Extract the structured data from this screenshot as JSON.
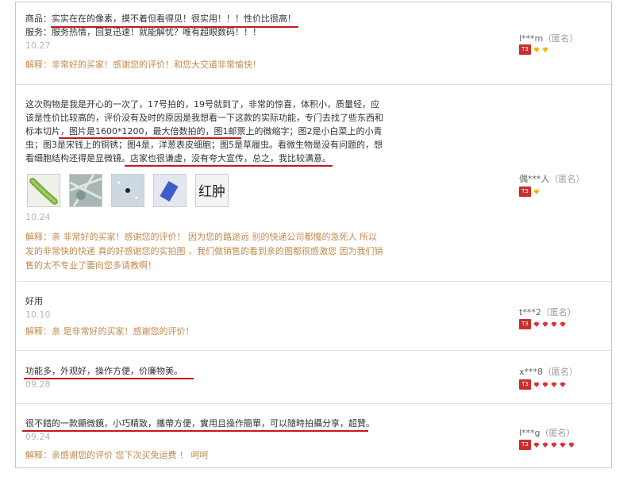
{
  "reviews": [
    {
      "lines": [
        "商品：实实在在的像素，摸不着但看得见！很实用！！！性价比很高！",
        "服务：服务热情，回复迅速！就能解忧？唯有超眼数码！！！"
      ],
      "date": "10.27",
      "reply": "解释：非常好的买家！感谢您的评价！和您大交道非常愉快！",
      "user": "l***m",
      "anon": "（匿名）",
      "level": "T3",
      "gem_color": "#f2b705",
      "gem_count": 2
    },
    {
      "lines": [
        "这次购物是我是开心的一次了，17号拍的，19号就到了，非常的惊喜，体积小，质量轻，应",
        "该是性价比较高的，评价没有及时的原因是我想看一下这款的实际功能，专门去找了些东西和",
        "标本切片，图片是1600*1200，最大倍数拍的，图1邮票上的微缩字；图2是小白菜上的小青",
        "虫；图3是宋钱上的铜锈；图4是，洋葱表皮细胞；图5是草履虫。看微生物是没有问题的，想",
        "看细胞结构还得是显微镜。店家也很谦虚，没有夸大宣传，总之，我比较满意。"
      ],
      "date": "10.24",
      "reply_lines": [
        "解释：亲 非常好的买家！感谢您的评价！ 因为您的路途远 别的快递公司都慢的急死人 所以",
        "发的非常快的快递 真的好感谢您的实拍图 ，我们做销售的看到亲的图都很感激您 因为我们销",
        "售的太不专业了要向您多请教啊！"
      ],
      "user": "偶***人",
      "anon": "（匿名）",
      "level": "T3",
      "gem_color": "#f2b705",
      "gem_count": 1,
      "thumb_text": "红肿 "
    },
    {
      "lines": [
        "好用"
      ],
      "date": "10.10",
      "reply": "解释：亲 是非常好的买家！感谢您的评价！",
      "user": "t***2",
      "anon": "（匿名）",
      "level": "T3",
      "gem_color": "#e0323b",
      "gem_count": 4
    },
    {
      "lines": [
        "功能多，外观好，操作方便，价廉物美。"
      ],
      "date": "09.28",
      "user": "x***8",
      "anon": "（匿名）",
      "level": "T3",
      "gem_color": "#e0323b",
      "gem_count": 4
    },
    {
      "lines": [
        "很不錯的一款顯微鏡，小巧精致，攜帶方便，實用且操作簡單，可以隨時拍攝分享，超贊。"
      ],
      "date": "09.24",
      "reply": "解释：亲感谢您的评价 您下次买免运费 ！ 呵呵",
      "user": "l***g",
      "anon": "（匿名）",
      "level": "T3",
      "gem_color": "#e0323b",
      "gem_count": 5
    }
  ],
  "thumb_caption": "红肿"
}
